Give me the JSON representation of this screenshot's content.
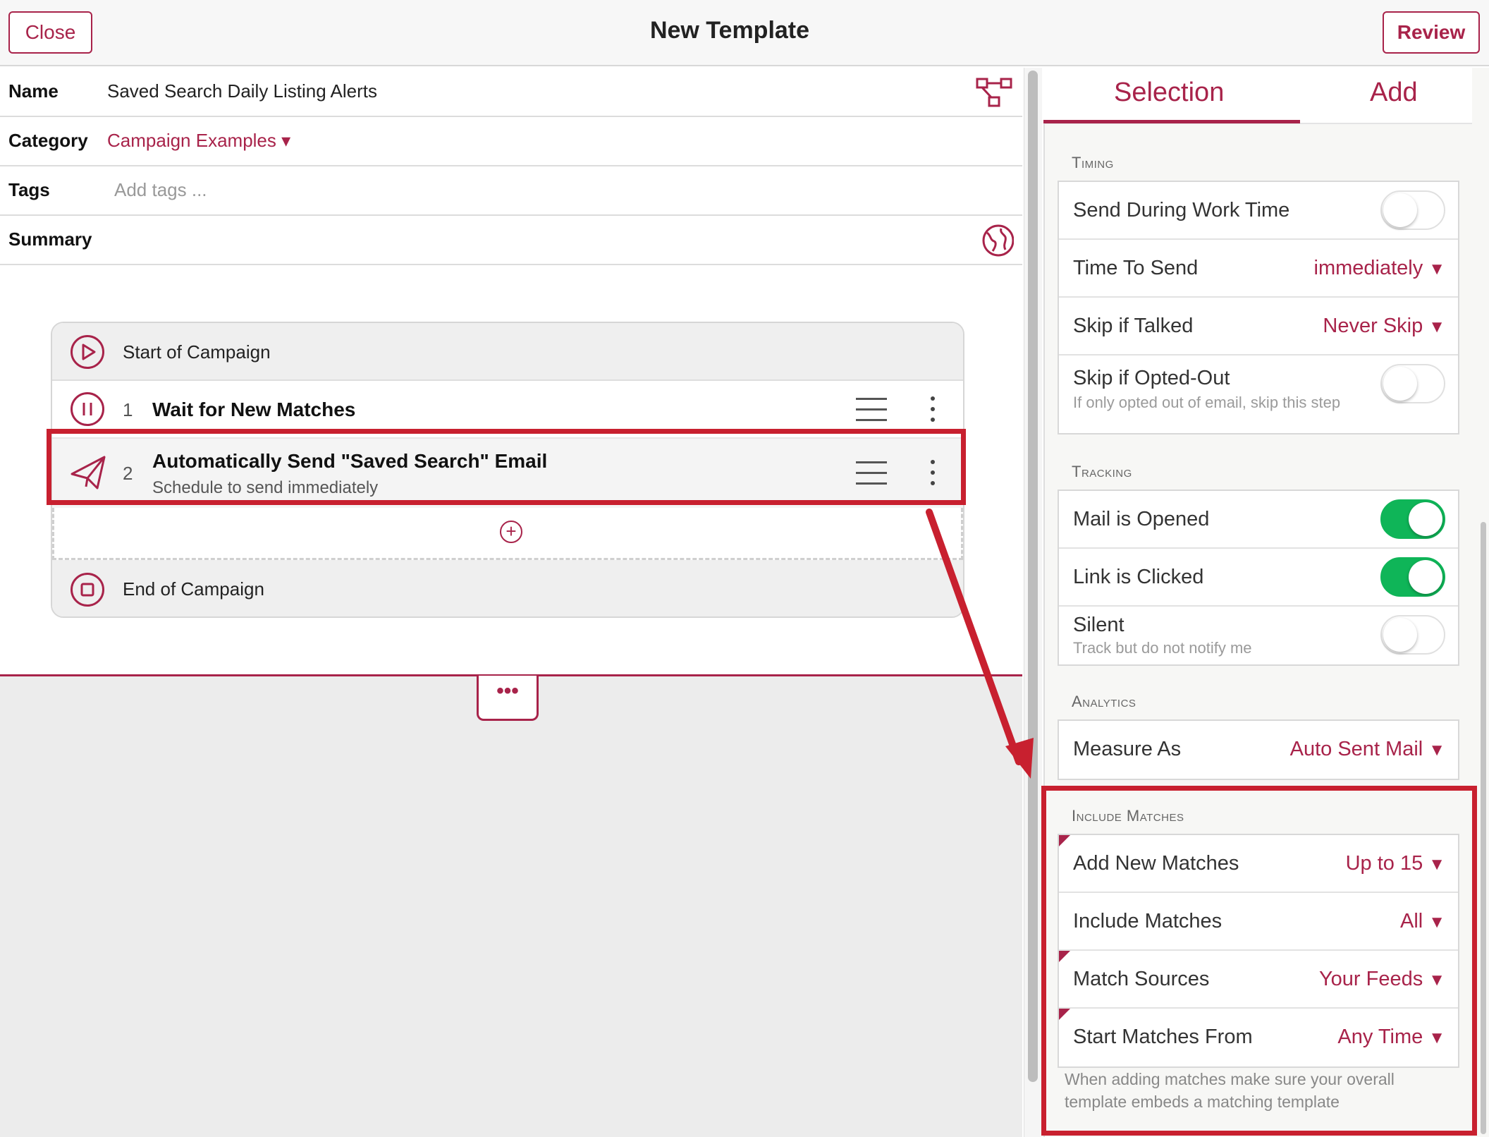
{
  "header": {
    "close_label": "Close",
    "title": "New Template",
    "review_label": "Review"
  },
  "form": {
    "name_label": "Name",
    "name_value": "Saved Search Daily Listing Alerts",
    "category_label": "Category",
    "category_value": "Campaign Examples ▾",
    "tags_label": "Tags",
    "tags_placeholder": "Add tags ...",
    "summary_label": "Summary"
  },
  "campaign": {
    "start_label": "Start of Campaign",
    "steps": [
      {
        "number": "1",
        "title": "Wait for New Matches",
        "subtitle": ""
      },
      {
        "number": "2",
        "title": "Automatically Send \"Saved Search\" Email",
        "subtitle": "Schedule to send immediately"
      }
    ],
    "end_label": "End of Campaign",
    "more_label": "•••"
  },
  "panel": {
    "tabs": [
      "Selection",
      "Add"
    ],
    "active_tab": "Selection",
    "timing": {
      "heading": "Timing",
      "send_during_work_time": {
        "label": "Send During Work Time",
        "on": false
      },
      "time_to_send": {
        "label": "Time To Send",
        "value": "immediately"
      },
      "skip_if_talked": {
        "label": "Skip if Talked",
        "value": "Never Skip"
      },
      "skip_if_opted_out": {
        "label": "Skip if Opted-Out",
        "sub": "If only opted out of email, skip this step",
        "on": false
      }
    },
    "tracking": {
      "heading": "Tracking",
      "mail_is_opened": {
        "label": "Mail is Opened",
        "on": true
      },
      "link_is_clicked": {
        "label": "Link is Clicked",
        "on": true
      },
      "silent": {
        "label": "Silent",
        "sub": "Track but do not notify me",
        "on": false
      }
    },
    "analytics": {
      "heading": "Analytics",
      "measure_as": {
        "label": "Measure As",
        "value": "Auto Sent Mail"
      }
    },
    "include_matches": {
      "heading": "Include Matches",
      "add_new_matches": {
        "label": "Add New Matches",
        "value": "Up to 15"
      },
      "include_matches": {
        "label": "Include Matches",
        "value": "All"
      },
      "match_sources": {
        "label": "Match Sources",
        "value": "Your Feeds"
      },
      "start_matches_from": {
        "label": "Start Matches From",
        "value": "Any Time"
      },
      "note": "When adding matches make sure your overall template embeds a matching template"
    }
  },
  "icons": {
    "flow": "flow-diagram-icon",
    "globe": "globe-icon",
    "start": "play-circle-icon",
    "wait": "pause-circle-icon",
    "send": "paper-plane-icon",
    "end": "stop-circle-icon",
    "add": "plus-circle-icon",
    "caret": "▼"
  },
  "colors": {
    "accent": "#a8234a",
    "annotation": "#c8202f",
    "toggle_on": "#0fb558"
  }
}
